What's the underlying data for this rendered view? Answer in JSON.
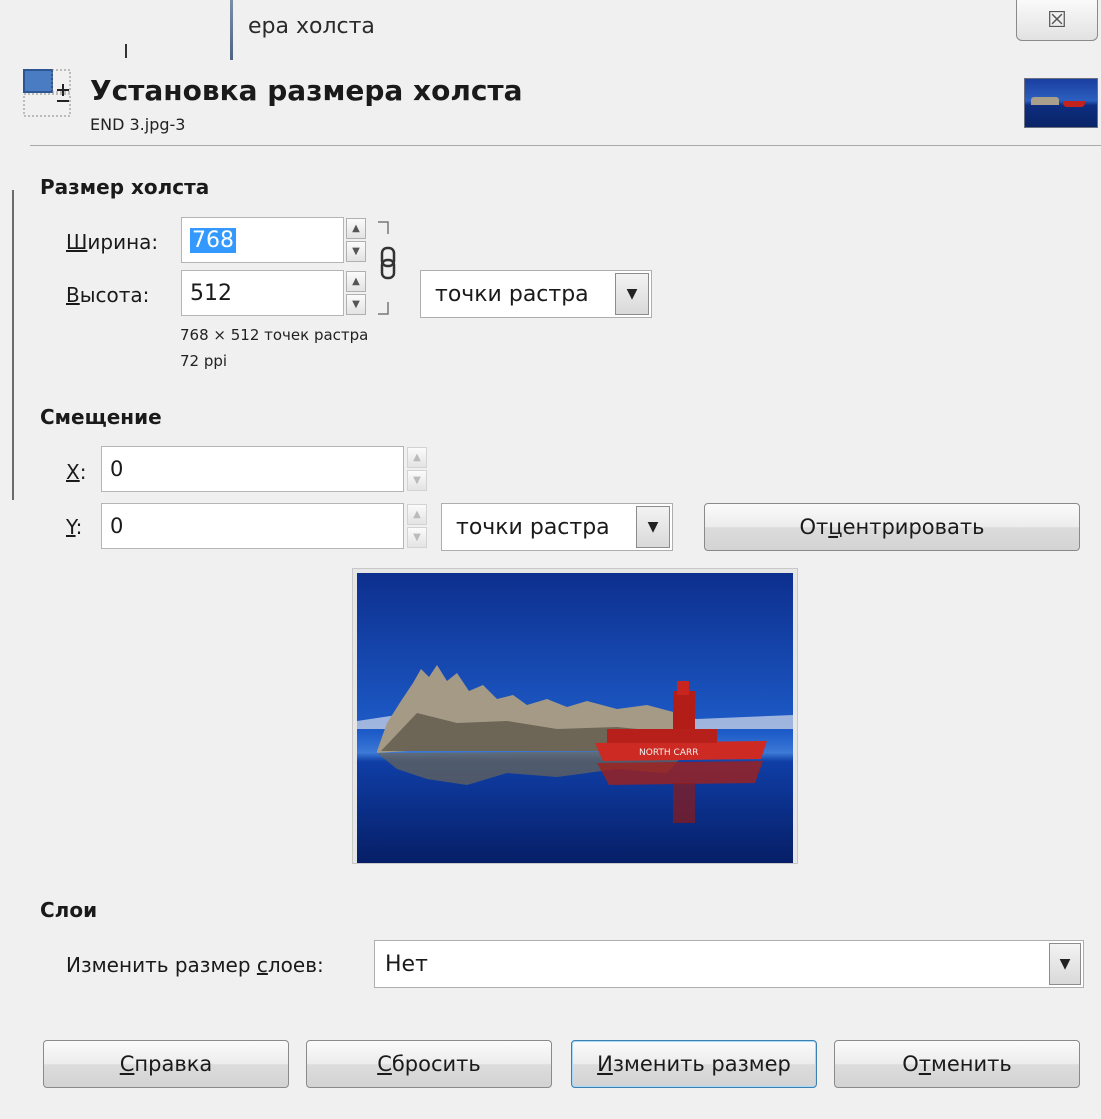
{
  "window": {
    "title_fragment": "ера холста",
    "close_symbol": "☒"
  },
  "header": {
    "title": "Установка размера холста",
    "subtitle": "END 3.jpg-3"
  },
  "canvas_size": {
    "section_label": "Размер холста",
    "width_label_accel": "Ш",
    "width_label_rest": "ирина:",
    "width_value": "768",
    "height_label_accel": "В",
    "height_label_rest": "ысота:",
    "height_value": "512",
    "unit_selected": "точки растра",
    "dimensions_info": "768 × 512 точек растра",
    "resolution_info": "72 ppi"
  },
  "offset": {
    "section_label": "Смещение",
    "x_label_accel": "X",
    "x_label_rest": ":",
    "x_value": "0",
    "y_label_accel": "Y",
    "y_label_rest": ":",
    "y_value": "0",
    "unit_selected": "точки растра",
    "center_button_pre": "От",
    "center_button_accel": "ц",
    "center_button_post": "ентрировать"
  },
  "preview": {
    "boat_text": "NORTH CARR"
  },
  "layers": {
    "section_label": "Слои",
    "resize_label_pre": "Изменить размер ",
    "resize_label_accel": "с",
    "resize_label_post": "лоев:",
    "resize_selected": "Нет"
  },
  "buttons": {
    "help_accel": "С",
    "help_rest": "правка",
    "reset_accel": "С",
    "reset_rest": "бросить",
    "resize_accel": "И",
    "resize_rest": "зменить размер",
    "cancel_pre": "О",
    "cancel_accel": "т",
    "cancel_post": "менить"
  },
  "colors": {
    "selection": "#3399ff",
    "sky": "#1d4fb8",
    "boat": "#c8241e"
  }
}
